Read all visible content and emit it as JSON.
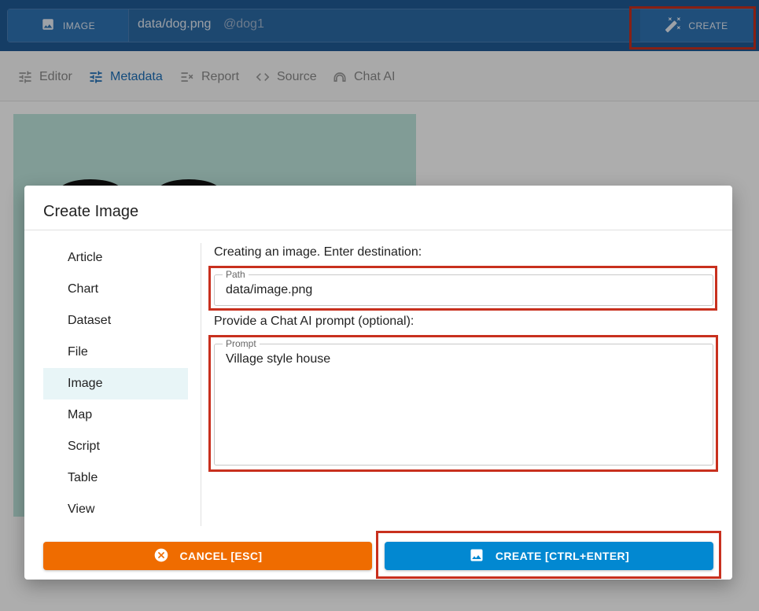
{
  "topbar": {
    "type_label": "IMAGE",
    "path": "data/dog.png",
    "alias": "@dog1",
    "create_label": "CREATE"
  },
  "tabs": [
    {
      "label": "Editor",
      "icon": "editor-sliders-icon",
      "active": false
    },
    {
      "label": "Metadata",
      "icon": "tune-icon",
      "active": true
    },
    {
      "label": "Report",
      "icon": "report-icon",
      "active": false
    },
    {
      "label": "Source",
      "icon": "code-icon",
      "active": false
    },
    {
      "label": "Chat AI",
      "icon": "chat-ai-icon",
      "active": false
    }
  ],
  "dialog": {
    "title": "Create Image",
    "menu": [
      "Article",
      "Chart",
      "Dataset",
      "File",
      "Image",
      "Map",
      "Script",
      "Table",
      "View"
    ],
    "selected": "Image",
    "destination_text": "Creating an image. Enter destination:",
    "path_label": "Path",
    "path_value": "data/image.png",
    "prompt_intro": "Provide a Chat AI prompt (optional):",
    "prompt_label": "Prompt",
    "prompt_value": "Village style house",
    "cancel_label": "CANCEL [ESC]",
    "create_label": "CREATE [CTRL+ENTER]"
  },
  "colors": {
    "topbar": "#1f5a96",
    "active_tab": "#1d6fb8",
    "cancel": "#ef6c00",
    "create": "#0288d1",
    "highlight": "#c8301e",
    "selected_item": "#e8f5f7"
  }
}
